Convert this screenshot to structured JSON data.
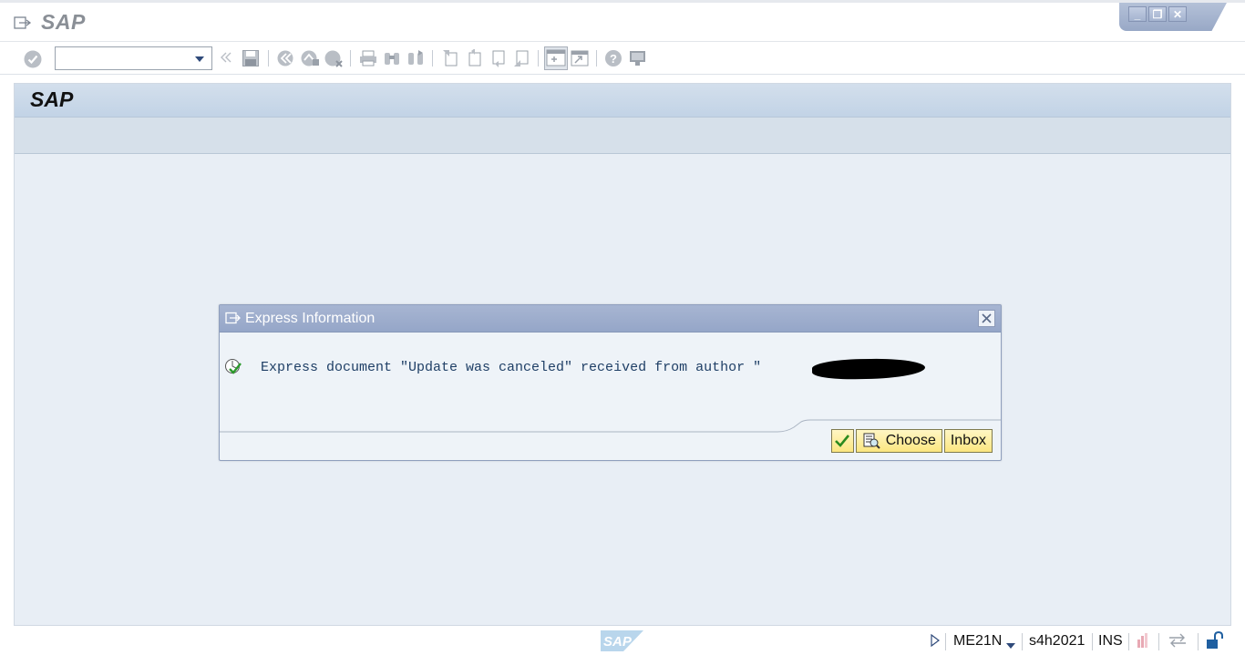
{
  "window": {
    "title": "SAP",
    "controls": {
      "minimize": "_",
      "restore": "❐",
      "close": "✕"
    }
  },
  "toolbar": {
    "command_field_value": "",
    "icons": [
      "enter-icon",
      "back-double-icon",
      "save-icon",
      "back-icon",
      "exit-icon",
      "cancel-icon",
      "print-icon",
      "find-icon",
      "find-next-icon",
      "first-page-icon",
      "previous-page-icon",
      "next-page-icon",
      "last-page-icon",
      "create-session-icon",
      "shortcut-icon",
      "help-icon",
      "layout-icon"
    ]
  },
  "main": {
    "title": "SAP"
  },
  "dialog": {
    "title": "Express Information",
    "message": "Express document \"Update was canceled\" received from author \"",
    "buttons": {
      "choose": "Choose",
      "inbox": "Inbox"
    }
  },
  "statusbar": {
    "transaction": "ME21N",
    "system": "s4h2021",
    "mode": "INS"
  },
  "colors": {
    "accent_blue": "#95a6c8",
    "button_yellow": "#fbe680",
    "background": "#e8eef5",
    "message_text": "#1f3f66"
  }
}
